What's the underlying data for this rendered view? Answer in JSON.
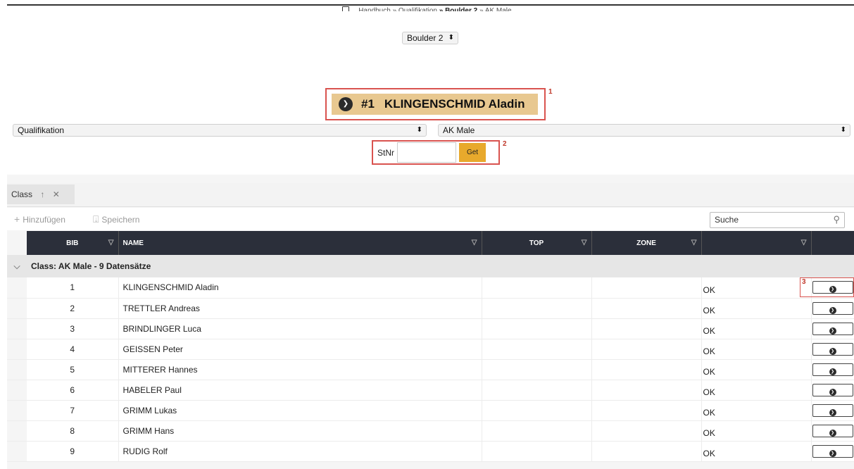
{
  "breadcrumb": {
    "part1": "Handbuch",
    "sep1": " » ",
    "part2": "Qualifikation",
    "sep2": " » ",
    "part3": "Boulder 2",
    "sep3": " » ",
    "part4": "AK Male"
  },
  "round_select": {
    "value": "Boulder 2"
  },
  "athlete": {
    "number": "#1",
    "name": "KLINGENSCHMID Aladin",
    "marker": "1"
  },
  "phase_select": {
    "value": "Qualifikation"
  },
  "class_select": {
    "value": "AK Male"
  },
  "stnr": {
    "label": "StNr",
    "value": "",
    "button": "Get",
    "marker": "2"
  },
  "group_panel": {
    "chip_label": "Class"
  },
  "toolbar": {
    "add_label": "Hinzufügen",
    "save_label": "Speichern",
    "search_placeholder": "Suche"
  },
  "table": {
    "headers": {
      "bib": "BIB",
      "name": "NAME",
      "top": "TOP",
      "zone": "ZONE",
      "status": ""
    },
    "group_label": "Class: AK Male - 9 Datensätze",
    "rows": [
      {
        "bib": "1",
        "name": "KLINGENSCHMID Aladin",
        "top": "",
        "zone": "",
        "status": "OK"
      },
      {
        "bib": "2",
        "name": "TRETTLER Andreas",
        "top": "",
        "zone": "",
        "status": "OK"
      },
      {
        "bib": "3",
        "name": "BRINDLINGER Luca",
        "top": "",
        "zone": "",
        "status": "OK"
      },
      {
        "bib": "4",
        "name": "GEISSEN Peter",
        "top": "",
        "zone": "",
        "status": "OK"
      },
      {
        "bib": "5",
        "name": "MITTERER Hannes",
        "top": "",
        "zone": "",
        "status": "OK"
      },
      {
        "bib": "6",
        "name": "HABELER Paul",
        "top": "",
        "zone": "",
        "status": "OK"
      },
      {
        "bib": "7",
        "name": "GRIMM Lukas",
        "top": "",
        "zone": "",
        "status": "OK"
      },
      {
        "bib": "8",
        "name": "GRIMM Hans",
        "top": "",
        "zone": "",
        "status": "OK"
      },
      {
        "bib": "9",
        "name": "RUDIG Rolf",
        "top": "",
        "zone": "",
        "status": "OK"
      }
    ],
    "marker3": "3"
  },
  "colors": {
    "accent": "#e8a92c",
    "highlight": "#d9534f",
    "header_bg": "#2b2f3a",
    "banner_bg": "#e8c890"
  }
}
